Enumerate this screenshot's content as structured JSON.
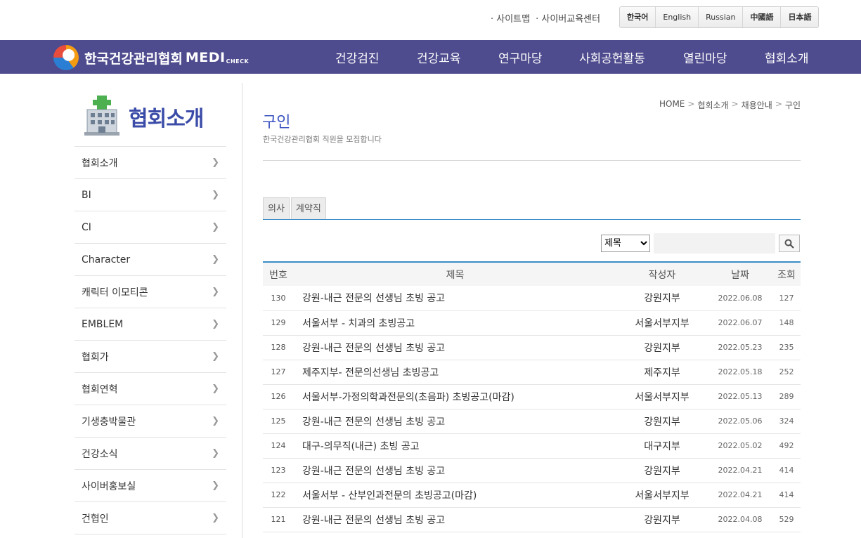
{
  "util": {
    "links": [
      "· 사이트맵",
      "· 사이버교육센터"
    ],
    "languages": [
      "한국어",
      "English",
      "Russian",
      "中國語",
      "日本語"
    ]
  },
  "logo": {
    "org": "한국건강관리협회",
    "medi": "MEDI",
    "check": "CHECK"
  },
  "gnb": [
    "건강검진",
    "건강교육",
    "연구마당",
    "사회공헌활동",
    "열린마당",
    "협회소개"
  ],
  "sidebar": {
    "title": "협회소개",
    "items": [
      "협회소개",
      "BI",
      "CI",
      "Character",
      "캐릭터 이모티콘",
      "EMBLEM",
      "협회가",
      "협회연혁",
      "기생충박물관",
      "건강소식",
      "사이버홍보실",
      "건협인"
    ]
  },
  "breadcrumb": [
    "HOME",
    "협회소개",
    "채용안내",
    "구인"
  ],
  "page": {
    "title": "구인",
    "subtitle": "한국건강관리협회 직원을 모집합니다"
  },
  "tabs": [
    "의사",
    "계약직"
  ],
  "search": {
    "field_selected": "제목",
    "query": ""
  },
  "board": {
    "headers": [
      "번호",
      "제목",
      "작성자",
      "날짜",
      "조회"
    ],
    "rows": [
      {
        "num": "130",
        "title": "강원-내근 전문의 선생님 초빙 공고",
        "writer": "강원지부",
        "date": "2022.06.08",
        "hits": "127"
      },
      {
        "num": "129",
        "title": "서울서부 - 치과의 초빙공고",
        "writer": "서울서부지부",
        "date": "2022.06.07",
        "hits": "148"
      },
      {
        "num": "128",
        "title": "강원-내근 전문의 선생님 초빙 공고",
        "writer": "강원지부",
        "date": "2022.05.23",
        "hits": "235"
      },
      {
        "num": "127",
        "title": "제주지부- 전문의선생님 초빙공고",
        "writer": "제주지부",
        "date": "2022.05.18",
        "hits": "252"
      },
      {
        "num": "126",
        "title": "서울서부-가정의학과전문의(초음파) 초빙공고(마감)",
        "writer": "서울서부지부",
        "date": "2022.05.13",
        "hits": "289"
      },
      {
        "num": "125",
        "title": "강원-내근 전문의 선생님 초빙 공고",
        "writer": "강원지부",
        "date": "2022.05.06",
        "hits": "324"
      },
      {
        "num": "124",
        "title": "대구-의무직(내근) 초빙 공고",
        "writer": "대구지부",
        "date": "2022.05.02",
        "hits": "492"
      },
      {
        "num": "123",
        "title": "강원-내근 전문의 선생님 초빙 공고",
        "writer": "강원지부",
        "date": "2022.04.21",
        "hits": "414"
      },
      {
        "num": "122",
        "title": "서울서부 - 산부인과전문의 초빙공고(마감)",
        "writer": "서울서부지부",
        "date": "2022.04.21",
        "hits": "414"
      },
      {
        "num": "121",
        "title": "강원-내근 전문의 선생님 초빙 공고",
        "writer": "강원지부",
        "date": "2022.04.08",
        "hits": "529"
      }
    ]
  },
  "colors": {
    "gnb_bg": "#4e4b8e",
    "accent_blue": "#3a8cc9",
    "title_blue": "#3c54c2"
  }
}
